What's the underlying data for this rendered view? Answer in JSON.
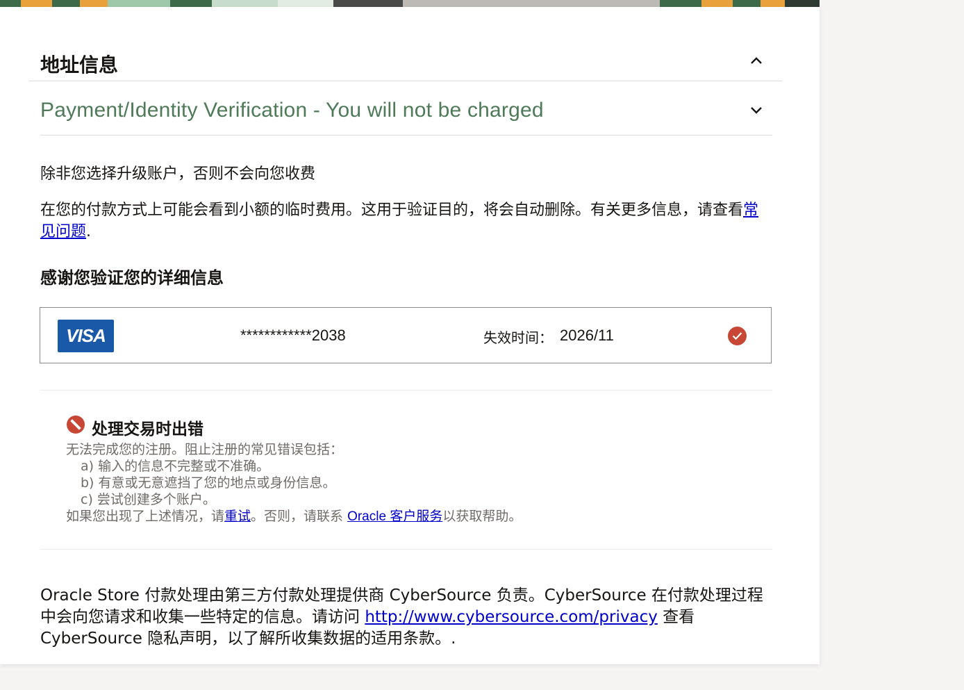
{
  "address": {
    "title": "地址信息",
    "toggle_icon": "chevron-up-icon"
  },
  "payment": {
    "title": "Payment/Identity Verification - You will not be charged",
    "toggle_icon": "chevron-down-icon",
    "title_color": "#4e7a58",
    "notice": "除非您选择升级账户，否则不会向您收费",
    "info_prefix": "在您的付款方式上可能会看到小额的临时费用。这用于验证目的，将会自动删除。有关更多信息，请查看",
    "info_link": "常见问题",
    "info_suffix": ".",
    "thanks_heading": "感谢您验证您的详细信息"
  },
  "card": {
    "brand": "VISA",
    "brand_color": "#1a58a8",
    "number_masked": "************2038",
    "expiry_label": "失效时间：",
    "expiry_value": "2026/11",
    "verified_icon": "check-circle-icon",
    "verified_color": "#c74634"
  },
  "error": {
    "icon": "error-circle-icon",
    "title": "处理交易时出错",
    "intro": "无法完成您的注册。阻止注册的常见错误包括：",
    "items": [
      "a) 输入的信息不完整或不准确。",
      "b) 有意或无意遮挡了您的地点或身份信息。",
      "c) 尝试创建多个账户。"
    ],
    "action_prefix": "如果您出现了上述情况，请",
    "retry_link": "重试",
    "action_middle": "。否则，请联系 ",
    "support_link": "Oracle 客户服务",
    "action_suffix": "以获取帮助。"
  },
  "footer": {
    "text_prefix": "Oracle Store 付款处理由第三方付款处理提供商 CyberSource 负责。CyberSource 在付款处理过程中会向您请求和收集一些特定的信息。请访问 ",
    "privacy_link": "http://www.cybersource.com/privacy",
    "text_suffix": " 查看 CyberSource 隐私声明，以了解所收集数据的适用条款。."
  }
}
